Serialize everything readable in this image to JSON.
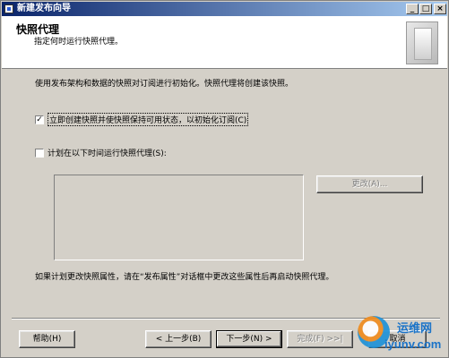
{
  "window": {
    "title": "新建发布向导",
    "minimize_glyph": "_",
    "maximize_glyph": "□",
    "close_glyph": "×"
  },
  "header": {
    "title": "快照代理",
    "subtitle": "指定何时运行快照代理。"
  },
  "main": {
    "intro": "使用发布架构和数据的快照对订阅进行初始化。快照代理将创建该快照。",
    "option_create_now": {
      "label": "立即创建快照并使快照保持可用状态，以初始化订阅(C)",
      "checked": true,
      "check_glyph": "✓"
    },
    "option_schedule": {
      "label": "计划在以下时间运行快照代理(S):",
      "checked": false
    },
    "change_button": "更改(A)...",
    "note": "如果计划更改快照属性，请在“发布属性”对话框中更改这些属性后再启动快照代理。"
  },
  "footer": {
    "help": "帮助(H)",
    "back": "< 上一步(B)",
    "next": "下一步(N) >",
    "finish": "完成(F) >>|",
    "cancel": "取消"
  },
  "watermark": {
    "line1": "运维网",
    "line2": "iyunv.com"
  }
}
